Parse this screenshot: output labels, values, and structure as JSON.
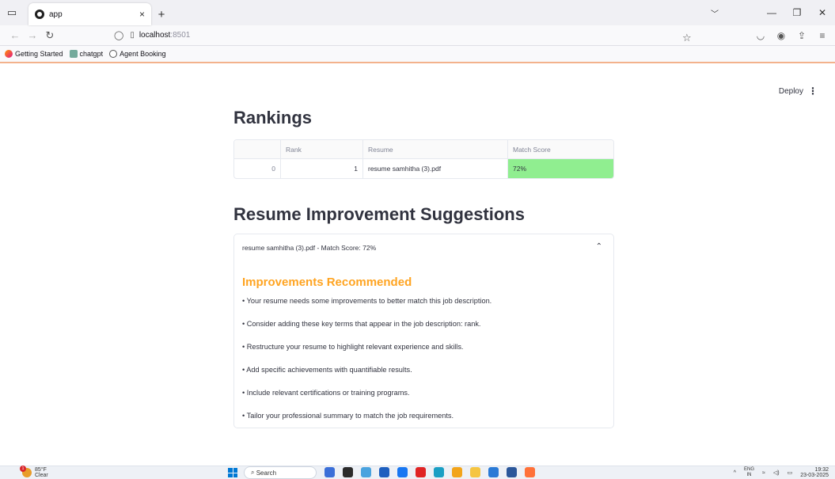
{
  "browser": {
    "tab_title": "app",
    "tab_close": "×",
    "new_tab": "+",
    "url_host": "localhost",
    "url_port": ":8501",
    "bookmarks": [
      "Getting Started",
      "chatgpt",
      "Agent Booking"
    ]
  },
  "header": {
    "deploy_label": "Deploy",
    "menu_glyph": "⋮"
  },
  "rankings": {
    "title": "Rankings",
    "columns": [
      "",
      "Rank",
      "Resume",
      "Match Score"
    ],
    "rows": [
      {
        "index": "0",
        "rank": "1",
        "resume": "resume samhitha (3).pdf",
        "score": "72%"
      }
    ],
    "score_color": "#90ee90"
  },
  "suggestions": {
    "title": "Resume Improvement Suggestions",
    "expander_label": "resume samhitha (3).pdf - Match Score: 72%",
    "expander_chevron": "⌃",
    "heading": "Improvements Recommended",
    "heading_color": "#ffa421",
    "items": [
      "• Your resume needs some improvements to better match this job description.",
      "• Consider adding these key terms that appear in the job description: rank.",
      "• Restructure your resume to highlight relevant experience and skills.",
      "• Add specific achievements with quantifiable results.",
      "• Include relevant certifications or training programs.",
      "• Tailor your professional summary to match the job requirements."
    ]
  },
  "taskbar": {
    "weather_temp": "85°F",
    "weather_desc": "Clear",
    "weather_badge": "1",
    "search_label": "Search",
    "lang_top": "ENG",
    "lang_bottom": "IN",
    "time": "19:32",
    "date": "23-03-2025"
  }
}
